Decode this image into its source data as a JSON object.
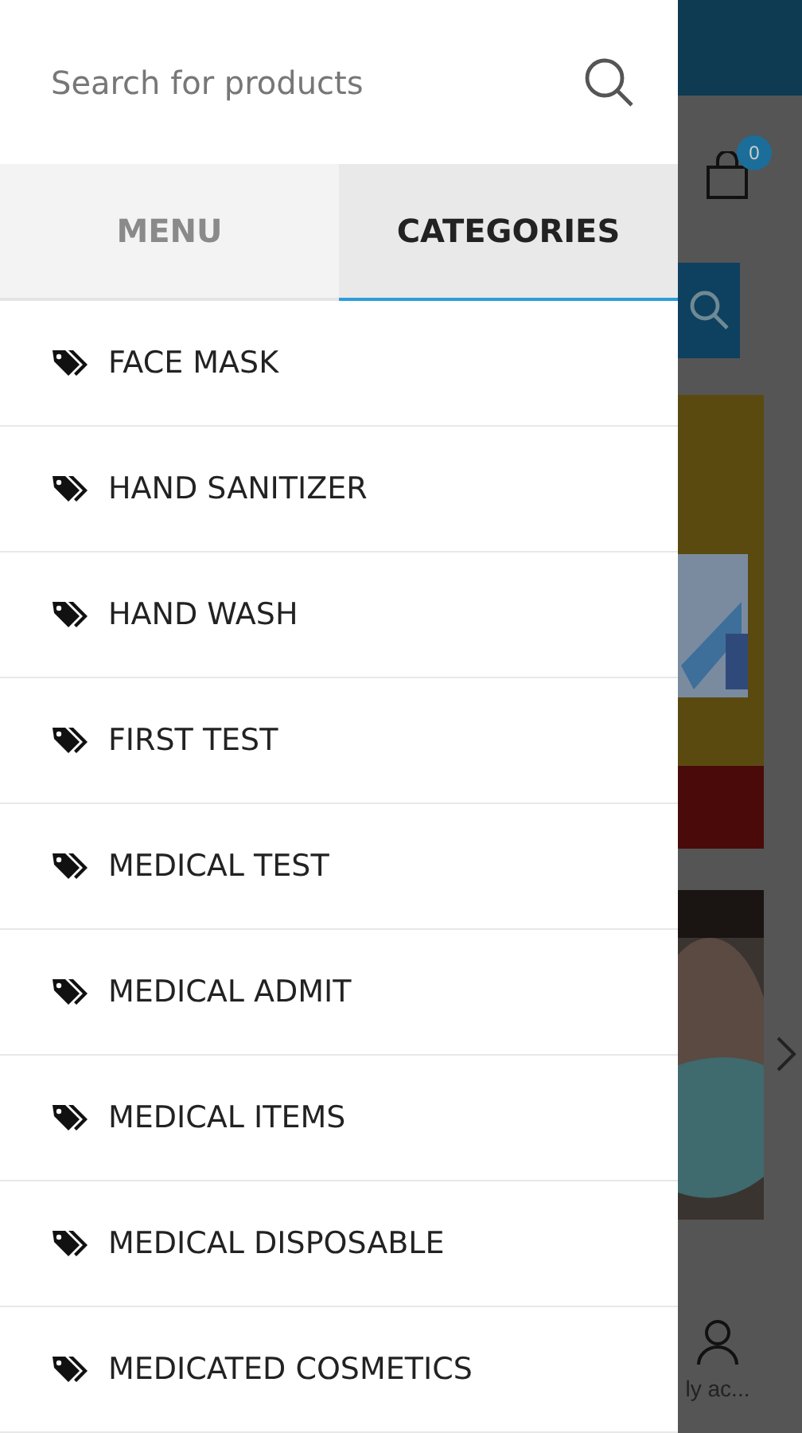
{
  "search": {
    "placeholder": "Search for products"
  },
  "tabs": [
    {
      "label": "MENU",
      "selected": false
    },
    {
      "label": "CATEGORIES",
      "selected": true
    }
  ],
  "categories": [
    {
      "label": "FACE MASK"
    },
    {
      "label": "HAND SANITIZER"
    },
    {
      "label": "HAND WASH"
    },
    {
      "label": "FIRST TEST"
    },
    {
      "label": "MEDICAL TEST"
    },
    {
      "label": "MEDICAL ADMIT"
    },
    {
      "label": "MEDICAL ITEMS"
    },
    {
      "label": "MEDICAL DISPOSABLE"
    },
    {
      "label": "MEDICATED COSMETICS"
    }
  ],
  "background_page": {
    "cart_badge": "0",
    "account_label": "ly ac..."
  }
}
